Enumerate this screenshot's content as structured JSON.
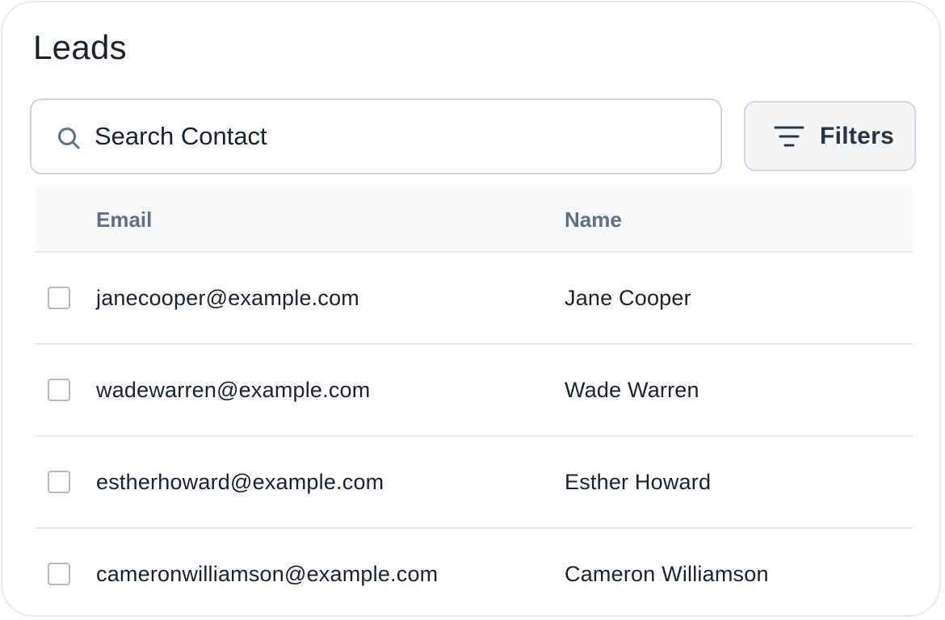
{
  "page": {
    "title": "Leads"
  },
  "search": {
    "placeholder": "Search Contact",
    "value": "",
    "icon": "search-icon"
  },
  "filters": {
    "label": "Filters",
    "icon": "filter-lines-icon"
  },
  "table": {
    "columns": [
      "Email",
      "Name"
    ],
    "rows": [
      {
        "email": "janecooper@example.com",
        "name": "Jane Cooper",
        "checked": false
      },
      {
        "email": "wadewarren@example.com",
        "name": "Wade Warren",
        "checked": false
      },
      {
        "email": "estherhoward@example.com",
        "name": "Esther Howard",
        "checked": false
      },
      {
        "email": "cameronwilliamson@example.com",
        "name": "Cameron Williamson",
        "checked": false
      }
    ]
  },
  "colors": {
    "text": "#1c2130",
    "header_text": "#5f6f85",
    "border": "#e9eaee",
    "header_bg": "#f8f9fa"
  }
}
